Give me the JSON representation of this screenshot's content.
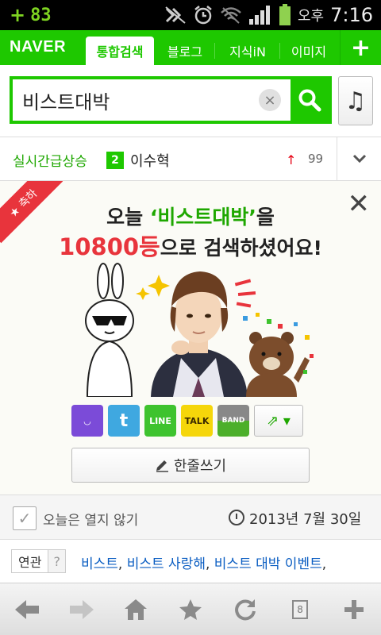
{
  "status_bar": {
    "left_plus": "+",
    "left_value": "83",
    "ampm": "오후",
    "time": "7:16",
    "accent_color": "#7ed321",
    "icons": [
      "mute-icon",
      "alarm-icon",
      "wifi-icon",
      "signal-icon",
      "battery-icon"
    ]
  },
  "navbar": {
    "logo": "NAVER",
    "tabs": [
      {
        "label": "통합검색",
        "active": true
      },
      {
        "label": "블로그",
        "active": false
      },
      {
        "label": "지식iN",
        "active": false
      },
      {
        "label": "이미지",
        "active": false
      }
    ],
    "plus": "+",
    "brand_color": "#1ec800"
  },
  "search": {
    "query": "비스트대박",
    "clear_icon": "×",
    "music_icon": "♫"
  },
  "realtime": {
    "label": "실시간급상승",
    "rank": "2",
    "keyword": "이수혁",
    "trend_icon": "↑",
    "change": "99",
    "expand_icon": "⌄"
  },
  "card": {
    "ribbon": "★ 축하",
    "close": "✕",
    "line1_prefix": "오늘 ",
    "line1_quote": "‘비스트대박’",
    "line1_suffix": "을",
    "line2_count": "10800등",
    "line2_suffix": "으로 검색하셨어요!",
    "share": [
      {
        "name": "naver-me",
        "label": "◡",
        "color": "#7b4bd8"
      },
      {
        "name": "twitter",
        "label": "t",
        "color": "#3fa8e0"
      },
      {
        "name": "line",
        "label": "LINE",
        "color": "#3ec32e"
      },
      {
        "name": "kakaotalk",
        "label": "TALK",
        "color": "#f5d60a"
      },
      {
        "name": "band",
        "label": "BAND",
        "color": "#4caf2a"
      }
    ],
    "share_more": "⇗ ▾",
    "comment_label": "한줄쓰기"
  },
  "info": {
    "checkbox_label": "오늘은 열지 않기",
    "date": "2013년 7월 30일"
  },
  "related": {
    "label": "연관",
    "help": "?",
    "links": [
      "비스트",
      "비스트 사랑해",
      "비스트 대박 이벤트"
    ]
  },
  "bottombar": {
    "tab_count": "8",
    "buttons": [
      "back-icon",
      "forward-icon",
      "home-icon",
      "bookmark-icon",
      "refresh-icon",
      "tabs-icon",
      "add-tab-icon"
    ]
  }
}
